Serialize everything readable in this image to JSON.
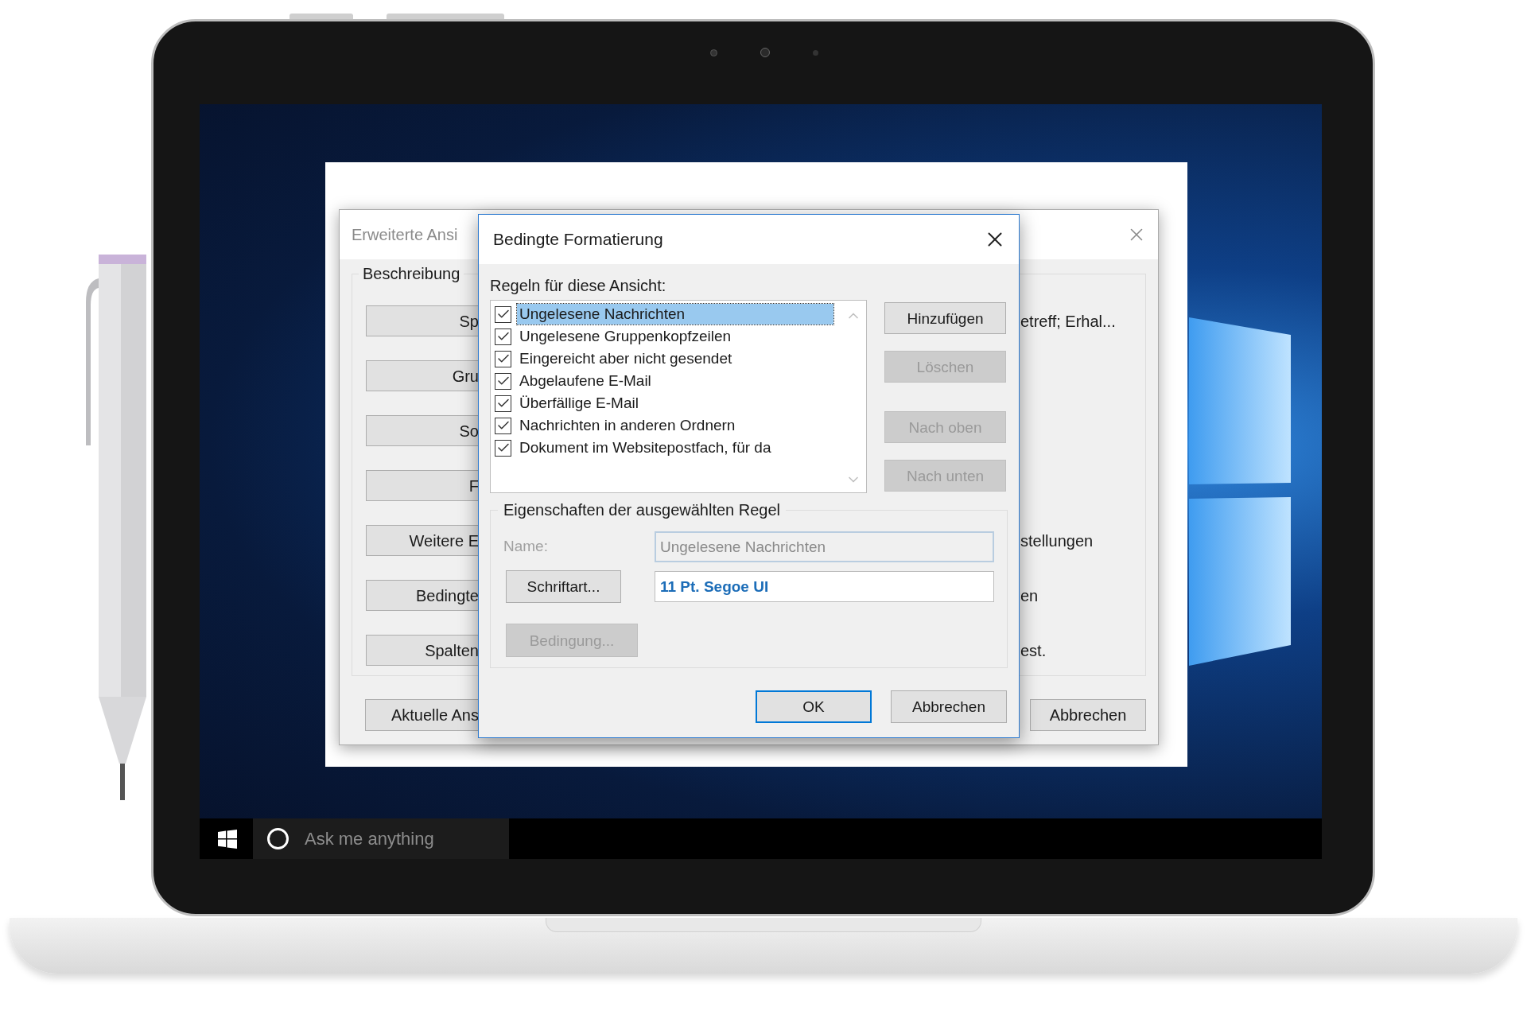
{
  "background_window": {
    "title": "Erweiterte Ansi",
    "group_label": "Beschreibung",
    "rows": [
      {
        "button": "Sp",
        "text": "etreff; Erhal..."
      },
      {
        "button": "Gru"
      },
      {
        "button": "So"
      },
      {
        "button": "F"
      },
      {
        "button": "Weitere E",
        "text": "stellungen"
      },
      {
        "button": "Bedingte",
        "text": "en"
      },
      {
        "button": "Spalten",
        "text": "est."
      }
    ],
    "footer_buttons": [
      "Aktuelle Ans",
      "Abbrechen"
    ]
  },
  "dialog": {
    "title": "Bedingte Formatierung",
    "rules_label": "Regeln für diese Ansicht:",
    "rules": [
      {
        "label": "Ungelesene Nachrichten",
        "checked": true,
        "selected": true
      },
      {
        "label": "Ungelesene Gruppenkopfzeilen",
        "checked": true,
        "selected": false
      },
      {
        "label": "Eingereicht aber nicht gesendet",
        "checked": true,
        "selected": false
      },
      {
        "label": "Abgelaufene E-Mail",
        "checked": true,
        "selected": false
      },
      {
        "label": "Überfällige E-Mail",
        "checked": true,
        "selected": false
      },
      {
        "label": "Nachrichten in anderen Ordnern",
        "checked": true,
        "selected": false
      },
      {
        "label": "Dokument im Websitepostfach, für da",
        "checked": true,
        "selected": false
      }
    ],
    "side_buttons": [
      {
        "label": "Hinzufügen",
        "disabled": false
      },
      {
        "label": "Löschen",
        "disabled": true
      },
      {
        "label": "Nach oben",
        "disabled": true
      },
      {
        "label": "Nach unten",
        "disabled": true
      }
    ],
    "properties": {
      "legend": "Eigenschaften der ausgewählten Regel",
      "name": {
        "label": "Name:",
        "value": "Ungelesene Nachrichten",
        "disabled": true
      },
      "font": {
        "button": "Schriftart...",
        "value": "11 Pt. Segoe UI"
      },
      "condition_button": {
        "label": "Bedingung...",
        "disabled": true
      }
    },
    "buttons": [
      {
        "label": "OK",
        "default": true
      },
      {
        "label": "Abbrechen",
        "default": false
      }
    ]
  },
  "taskbar": {
    "search_placeholder": "Ask me anything"
  }
}
